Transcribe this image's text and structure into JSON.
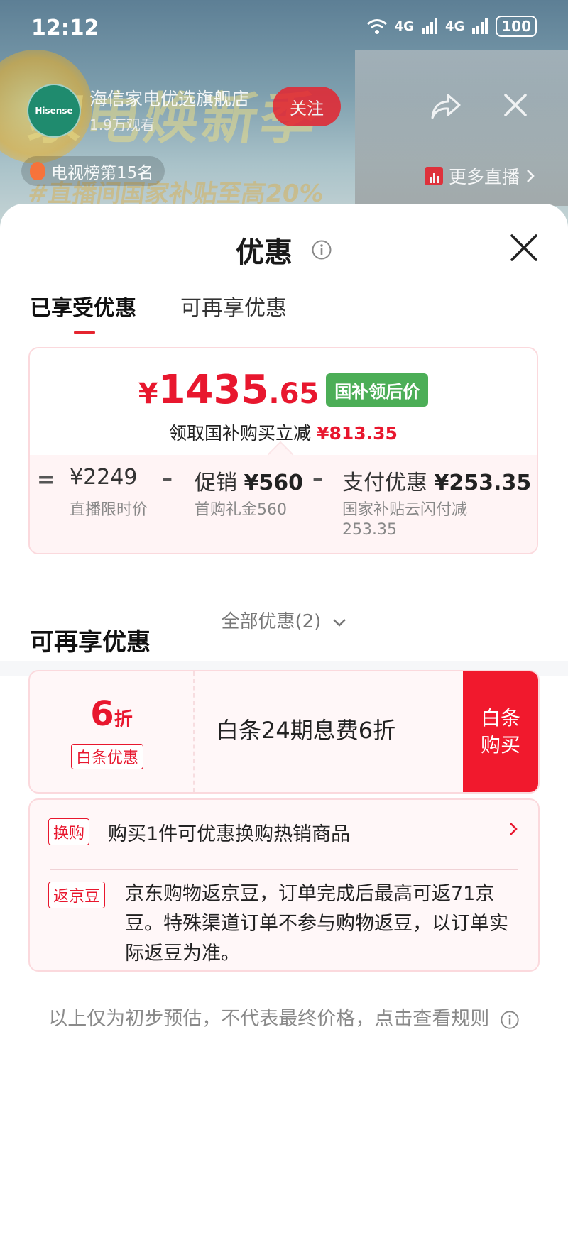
{
  "status_bar": {
    "time": "12:12",
    "battery": "100",
    "signal1": "4G",
    "signal2": "4G"
  },
  "live": {
    "banner_title": "家电焕新季",
    "banner_sub": "#直播间国家补贴至高20%",
    "shop_logo": "Hisense",
    "shop_name": "海信家电优选旗舰店",
    "viewers": "1.9万观看",
    "follow_label": "关注",
    "rank": "电视榜第15名",
    "more_live": "更多直播"
  },
  "sheet": {
    "title": "优惠",
    "tabs": [
      {
        "label": "已享受优惠",
        "active": true
      },
      {
        "label": "可再享优惠",
        "active": false
      }
    ],
    "price": {
      "currency": "¥",
      "integer": "1435",
      "decimal": ".65",
      "badge": "国补领后价",
      "reduce_label": "领取国补购买立减",
      "reduce_value": "¥813.35"
    },
    "breakdown": {
      "equals": "=",
      "minus": "–",
      "items": [
        {
          "main_label": "",
          "main_value": "¥2249",
          "sub": "直播限时价"
        },
        {
          "main_label": "促销",
          "main_value": "¥560",
          "sub": "首购礼金560"
        },
        {
          "main_label": "支付优惠",
          "main_value": "¥253.35",
          "sub": "国家补贴云闪付减253.35"
        }
      ]
    },
    "all_discounts": "全部优惠(2)",
    "more_section_title": "可再享优惠",
    "baitiao": {
      "discount_num": "6",
      "discount_unit": "折",
      "tag": "白条优惠",
      "desc": "白条24期息费6折",
      "buy_label_line1": "白条",
      "buy_label_line2": "购买"
    },
    "exchange": {
      "tag": "换购",
      "text": "购买1件可优惠换购热销商品"
    },
    "jingdou": {
      "tag": "返京豆",
      "text": "京东购物返京豆，订单完成后最高可返71京豆。特殊渠道订单不参与购物返豆，以订单实际返豆为准。"
    },
    "footer_note": "以上仅为初步预估，不代表最终价格，点击查看规则"
  },
  "colors": {
    "accent": "#e8172e",
    "badge_green": "#4cae57",
    "card_border": "#fbd9dd"
  }
}
